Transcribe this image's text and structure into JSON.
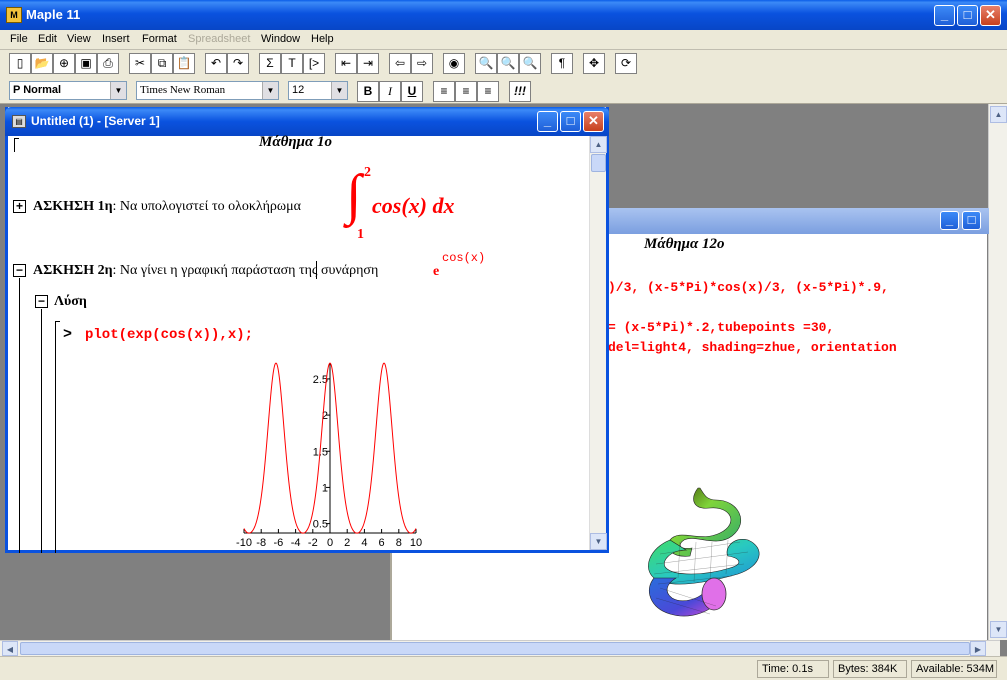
{
  "app": {
    "title": "Maple 11"
  },
  "menus": [
    "File",
    "Edit",
    "View",
    "Insert",
    "Format",
    "Spreadsheet",
    "Window",
    "Help"
  ],
  "toolbar2": {
    "style": "P Normal",
    "font": "Times New Roman",
    "size": "12",
    "bold": "B",
    "italic": "I",
    "underline": "U",
    "exec": "!!!"
  },
  "front_window": {
    "title": "Untitled (1) - [Server 1]",
    "heading": "Μάθημα 1ο",
    "ex1_label": "ΑΣΚΗΣΗ 1η",
    "ex1_text": ": Να υπολογιστεί το ολοκλήρωμα",
    "ex1_upper": "2",
    "ex1_lower": "1",
    "ex1_integrand": "cos(x) dx",
    "ex2_label": "ΑΣΚΗΣΗ 2η",
    "ex2_text": ": Να γίνει η γραφική παράσταση της συνάρηση",
    "ex2_base": "e",
    "ex2_exp": "cos(x)",
    "solution_label": "Λύση",
    "prompt": ">",
    "command": "plot(exp(cos(x)),x);"
  },
  "back_window": {
    "heading": "Μάθημα 12ο",
    "lines": [
      ")/3, (x-5*Pi)*cos(x)/3, (x-5*Pi)*.9,",
      "= (x-5*Pi)*.2,tubepoints =30,",
      "del=light4, shading=zhue, orientation"
    ]
  },
  "chart_data": {
    "type": "line",
    "title": "",
    "xlabel": "",
    "ylabel": "",
    "xlim": [
      -10,
      10
    ],
    "ylim": [
      0.37,
      2.72
    ],
    "x_ticks": [
      "-10",
      "-8",
      "-6",
      "-4",
      "-2",
      "0",
      "2",
      "4",
      "6",
      "8",
      "10"
    ],
    "y_ticks": [
      "0.5",
      "1",
      "1.5",
      "2",
      "2.5"
    ],
    "function": "exp(cos(x))",
    "series": [
      {
        "color": "#ff0000"
      }
    ]
  },
  "status": {
    "time": "Time:  0.1s",
    "bytes": "Bytes:  384K",
    "available": "Available:  534M"
  }
}
